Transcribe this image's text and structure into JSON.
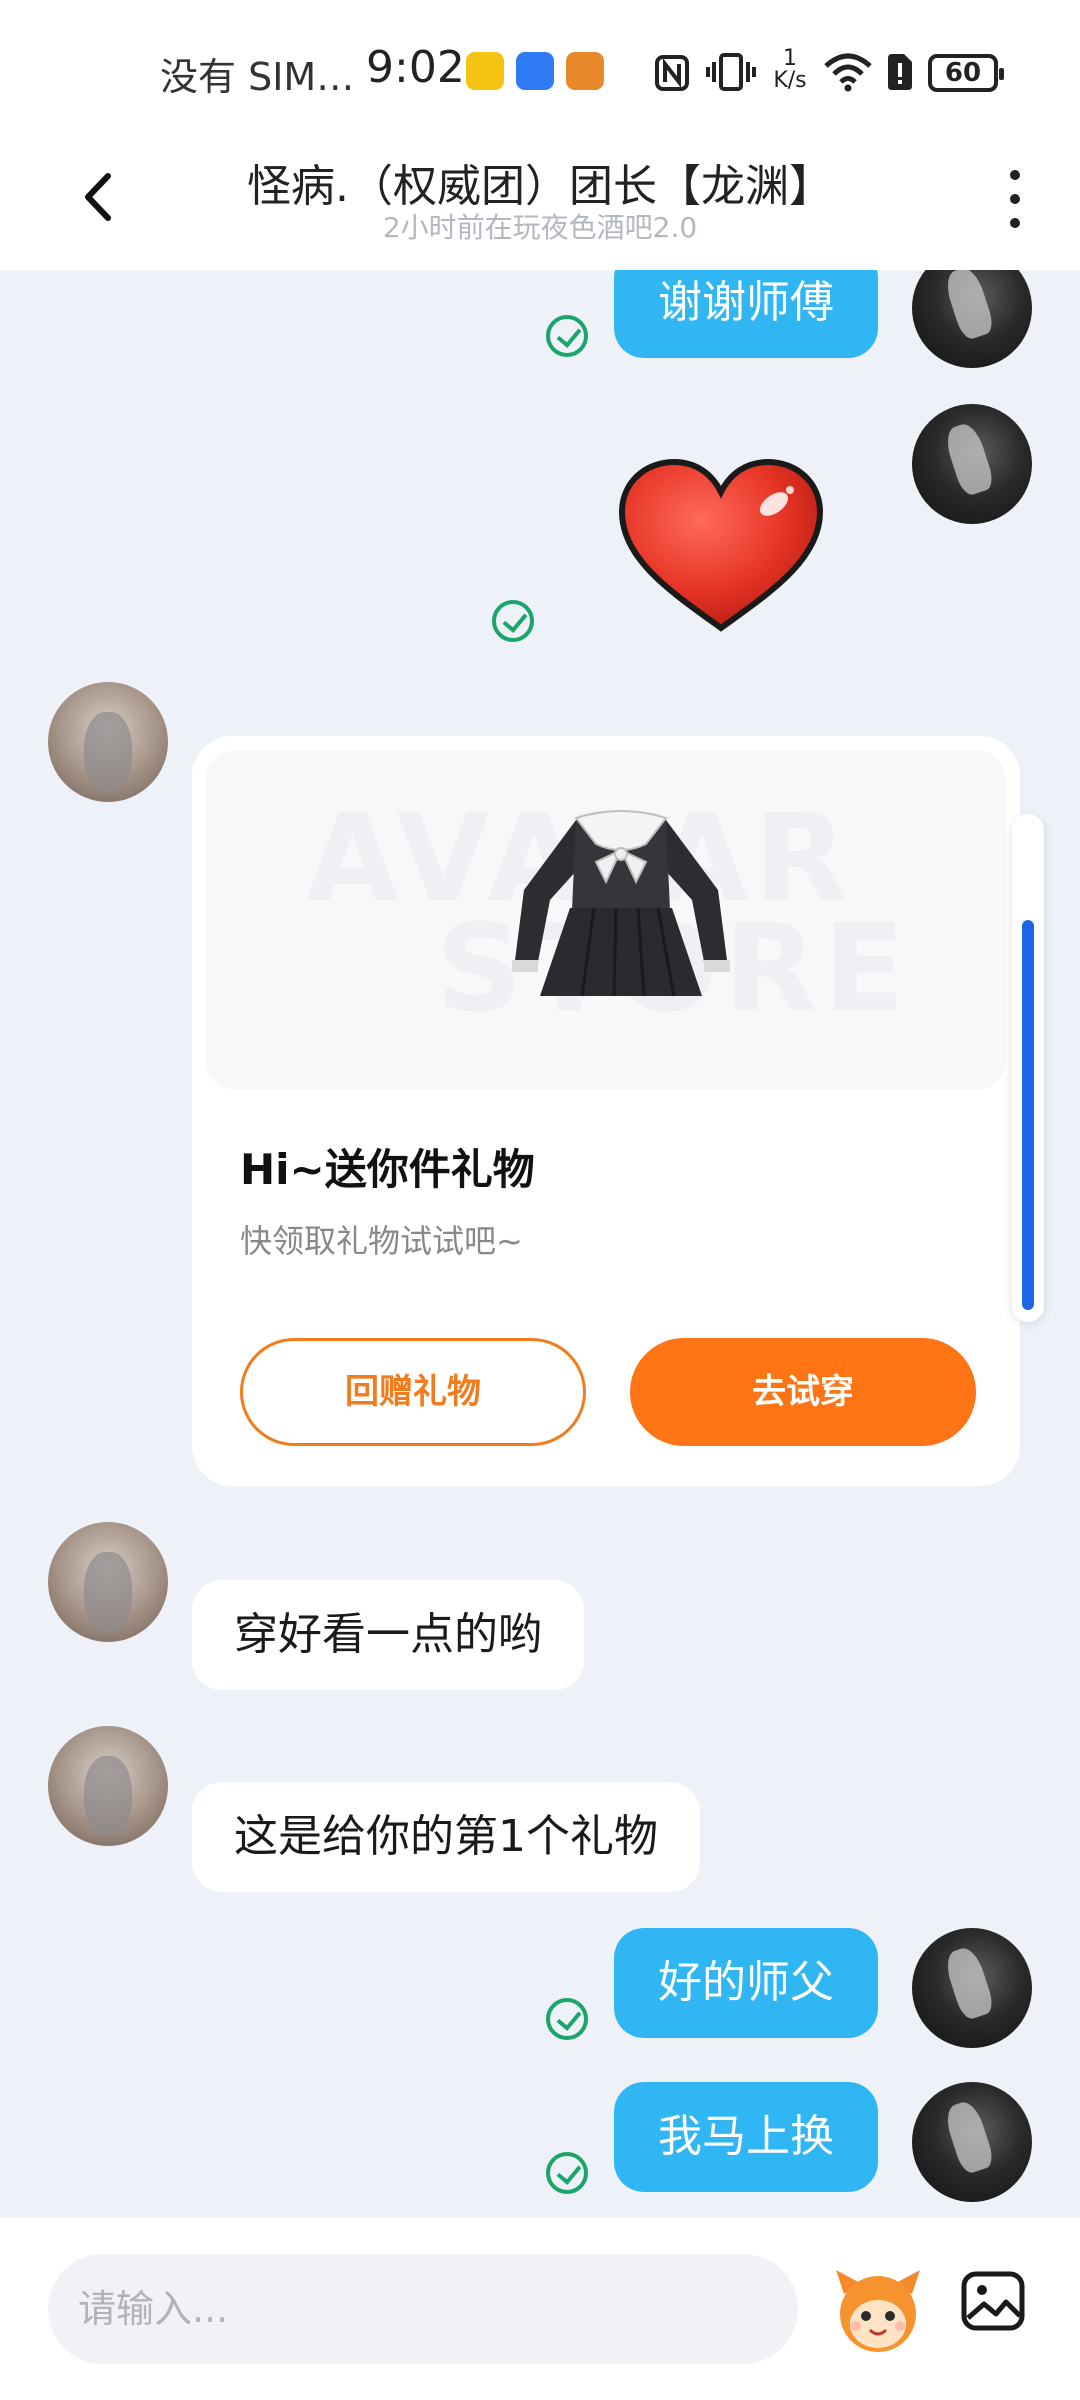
{
  "status_bar": {
    "carrier": "没有 SIM…",
    "time": "9:02",
    "net_speed_top": "1",
    "net_speed_unit": "K/s",
    "battery": "60"
  },
  "header": {
    "title": "怪病.（权威团）团长【龙渊】",
    "subtitle": "2小时前在玩夜色酒吧2.0"
  },
  "messages": {
    "m1": "谢谢师傅",
    "m3": "穿好看一点的哟",
    "m4": "这是给你的第1个礼物",
    "m5": "好的师父",
    "m6": "我马上换"
  },
  "gift_card": {
    "watermark_line1": "AVATAR",
    "watermark_line2": "STORE",
    "title": "Hi~送你件礼物",
    "subtitle": "快领取礼物试试吧~",
    "return_button": "回赠礼物",
    "try_button": "去试穿"
  },
  "input": {
    "placeholder": "请输入..."
  },
  "colors": {
    "bubble_me": "#2fb6f3",
    "bubble_her": "#ffffff",
    "accent_orange": "#ff7414",
    "read_check": "#1aa56a",
    "scroll_thumb": "#1e66e8",
    "background": "#eef2f8"
  },
  "icons": {
    "back": "chevron-left-icon",
    "more": "more-vertical-icon",
    "read": "check-circle-icon",
    "sticker": "heart-sticker",
    "mascot": "mascot-emoji-icon",
    "image": "image-icon"
  }
}
